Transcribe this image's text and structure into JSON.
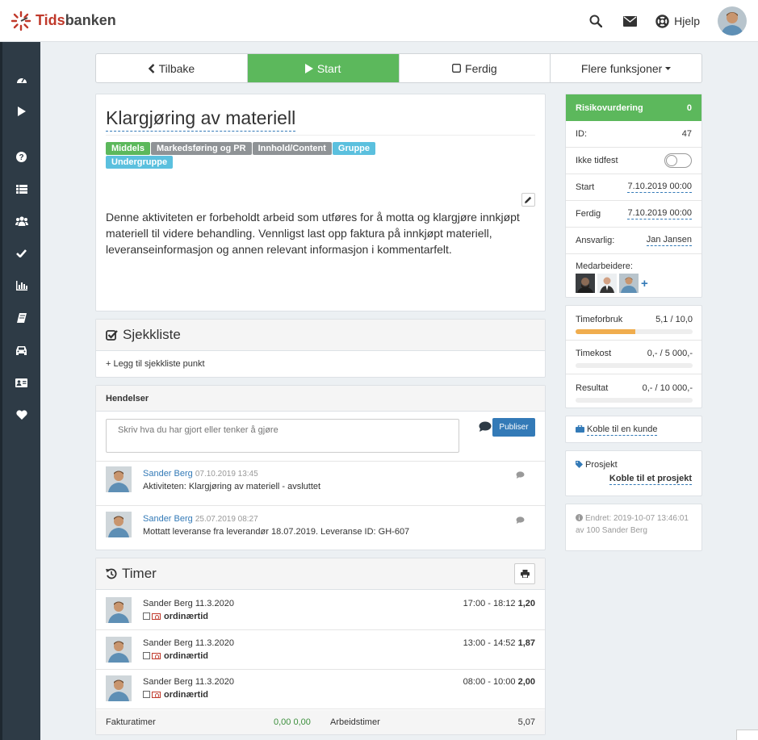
{
  "app": {
    "name_prefix": "Tids",
    "name_suffix": "banken",
    "help_label": "Hjelp"
  },
  "actions": {
    "back": "Tilbake",
    "start": "Start",
    "done": "Ferdig",
    "more": "Flere funksjoner"
  },
  "task": {
    "title": "Klargjøring av materiell",
    "tags": [
      {
        "label": "Middels",
        "color": "#5cb85c"
      },
      {
        "label": "Markedsføring og PR",
        "color": "#8f9396"
      },
      {
        "label": "Innhold/Content",
        "color": "#8f9396"
      },
      {
        "label": "Gruppe",
        "color": "#5bc0de"
      },
      {
        "label": "Undergruppe",
        "color": "#5bc0de"
      }
    ],
    "description": "Denne aktiviteten er forbeholdt arbeid som utføres for å motta og klargjøre innkjøpt materiell til videre behandling. Vennligst last opp faktura på innkjøpt materiell, leveranseinformasjon og annen relevant informasjon i kommentarfelt."
  },
  "checklist": {
    "title": "Sjekkliste",
    "add_label": "+ Legg til sjekkliste punkt"
  },
  "events": {
    "title": "Hendelser",
    "placeholder": "Skriv hva du har gjort eller tenker å gjøre",
    "publish_label": "Publiser",
    "items": [
      {
        "author": "Sander Berg",
        "time": "07.10.2019 13:45",
        "text": "Aktiviteten: Klargjøring av materiell - avsluttet"
      },
      {
        "author": "Sander Berg",
        "time": "25.07.2019 08:27",
        "text": "Mottatt leveranse fra leverandør 18.07.2019. Leveranse ID: GH-607"
      }
    ]
  },
  "timer": {
    "title": "Timer",
    "rows": [
      {
        "who": "Sander Berg 11.3.2020",
        "range": "17:00 - 18:12",
        "hours": "1,20",
        "type": "ordinærtid"
      },
      {
        "who": "Sander Berg 11.3.2020",
        "range": "13:00 - 14:52",
        "hours": "1,87",
        "type": "ordinærtid"
      },
      {
        "who": "Sander Berg 11.3.2020",
        "range": "08:00 - 10:00",
        "hours": "2,00",
        "type": "ordinærtid"
      }
    ],
    "footer": {
      "invoice_label": "Fakturatimer",
      "invoice_value": "0,00 0,00",
      "work_label": "Arbeidstimer",
      "work_value": "5,07"
    }
  },
  "details": {
    "risk_label": "Risikovurdering",
    "risk_value": "0",
    "id_label": "ID:",
    "id_value": "47",
    "unscheduled_label": "Ikke tidfest",
    "start_label": "Start",
    "start_value": "7.10.2019 00:00",
    "end_label": "Ferdig",
    "end_value": "7.10.2019 00:00",
    "owner_label": "Ansvarlig:",
    "owner_value": "Jan Jansen",
    "members_label": "Medarbeidere:",
    "members_add": "+"
  },
  "budget": [
    {
      "label": "Timeforbruk",
      "value": "5,1 / 10,0",
      "fill": 0.51
    },
    {
      "label": "Timekost",
      "value": "0,- / 5 000,-",
      "fill": 0
    },
    {
      "label": "Resultat",
      "value": "0,- / 10 000,-",
      "fill": 0
    }
  ],
  "customer": {
    "link": "Koble til en kunde"
  },
  "project": {
    "label": "Prosjekt",
    "link": "Koble til et prosjekt"
  },
  "changed": {
    "line1": "Endret: 2019-10-07 13:46:01",
    "line2": "av 100 Sander Berg"
  }
}
